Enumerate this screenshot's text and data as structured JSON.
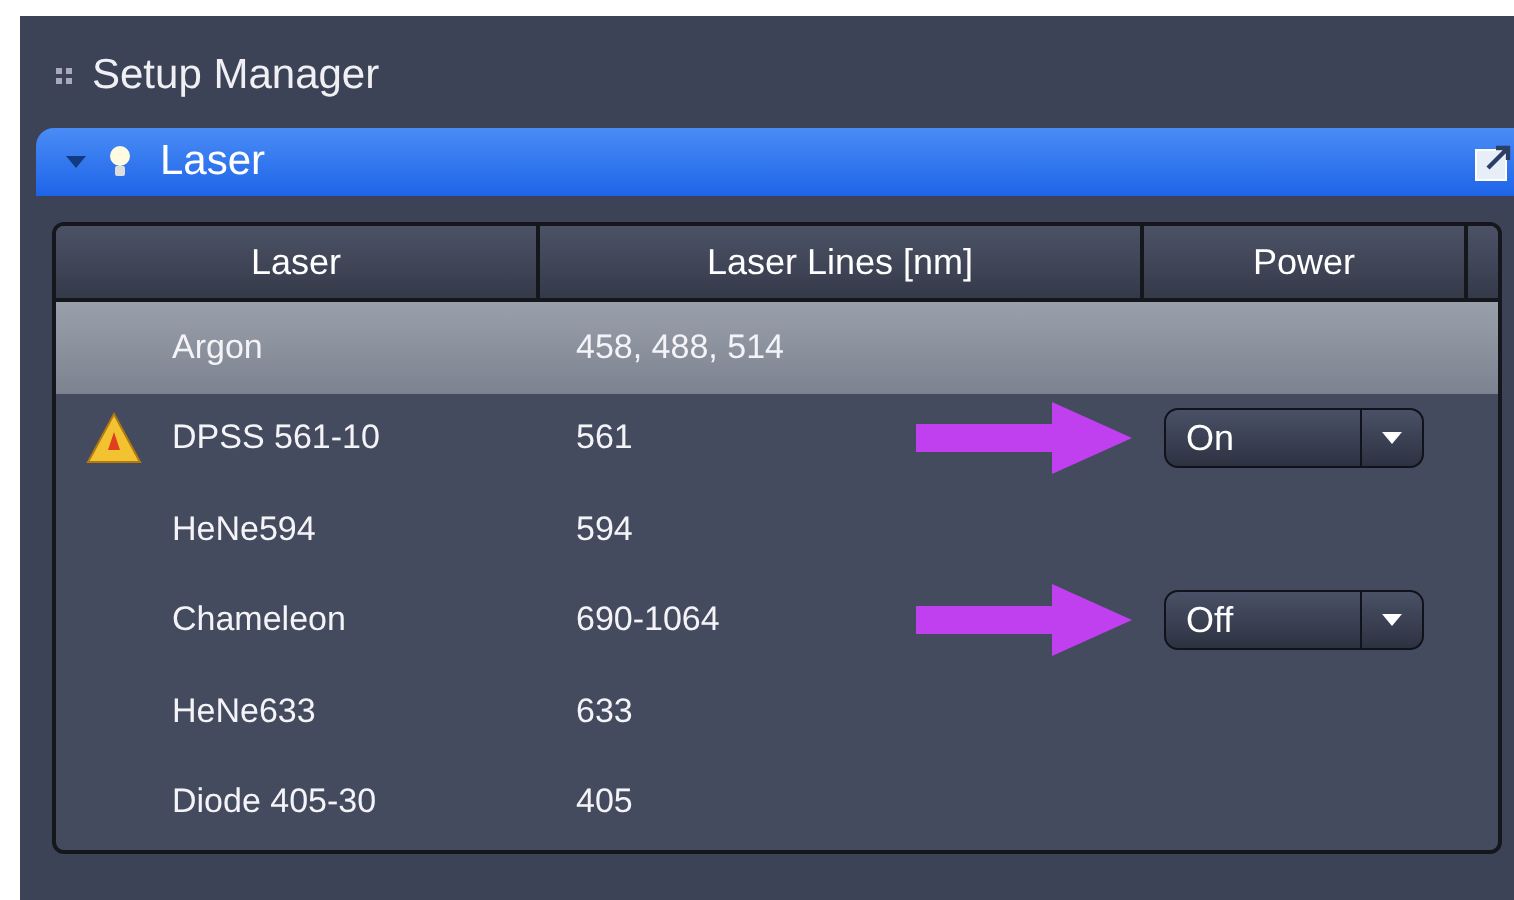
{
  "panel": {
    "title": "Setup Manager"
  },
  "section": {
    "title": "Laser",
    "expanded": true
  },
  "table": {
    "columns": [
      "Laser",
      "Laser Lines [nm]",
      "Power"
    ],
    "rows": [
      {
        "name": "Argon",
        "lines": "458, 488, 514",
        "selected": true,
        "warning": false,
        "annotated": false
      },
      {
        "name": "DPSS 561-10",
        "lines": "561",
        "selected": false,
        "warning": true,
        "annotated": true,
        "power": "On"
      },
      {
        "name": "HeNe594",
        "lines": "594",
        "selected": false,
        "warning": false,
        "annotated": false
      },
      {
        "name": "Chameleon",
        "lines": "690-1064",
        "selected": false,
        "warning": false,
        "annotated": true,
        "power": "Off"
      },
      {
        "name": "HeNe633",
        "lines": "633",
        "selected": false,
        "warning": false,
        "annotated": false
      },
      {
        "name": "Diode 405-30",
        "lines": "405",
        "selected": false,
        "warning": false,
        "annotated": false
      }
    ]
  }
}
